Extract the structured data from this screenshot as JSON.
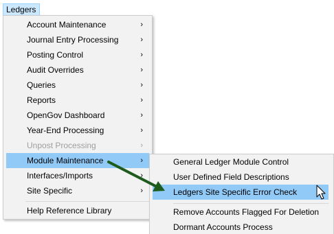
{
  "menubar": {
    "title": "Ledgers"
  },
  "menu": {
    "items": [
      {
        "label": "Account Maintenance",
        "has_submenu": true
      },
      {
        "label": "Journal Entry Processing",
        "has_submenu": true
      },
      {
        "label": "Posting Control",
        "has_submenu": true
      },
      {
        "label": "Audit Overrides",
        "has_submenu": true
      },
      {
        "label": "Queries",
        "has_submenu": true
      },
      {
        "label": "Reports",
        "has_submenu": true
      },
      {
        "label": "OpenGov Dashboard",
        "has_submenu": true
      },
      {
        "label": "Year-End Processing",
        "has_submenu": true
      },
      {
        "label": "Unpost Processing",
        "has_submenu": true,
        "disabled": true
      },
      {
        "label": "Module Maintenance",
        "has_submenu": true,
        "highlighted": true
      },
      {
        "label": "Interfaces/Imports",
        "has_submenu": true
      },
      {
        "label": "Site Specific",
        "has_submenu": true
      },
      {
        "label": "Help Reference Library",
        "has_submenu": false
      }
    ],
    "arrow_glyph": "›"
  },
  "submenu": {
    "items": [
      {
        "label": "General Ledger Module Control"
      },
      {
        "label": "User Defined Field Descriptions"
      },
      {
        "label": "Ledgers Site Specific Error Check",
        "highlighted": true
      },
      {
        "label": "Remove Accounts Flagged For Deletion"
      },
      {
        "label": "Dormant Accounts Process"
      }
    ]
  },
  "annotation": {
    "arrow_color": "#1e5c1e",
    "icon": "green-arrow-icon"
  },
  "colors": {
    "highlight": "#91c9f7",
    "menu_bg": "#f2f2f2",
    "disabled": "#9e9e9e"
  }
}
